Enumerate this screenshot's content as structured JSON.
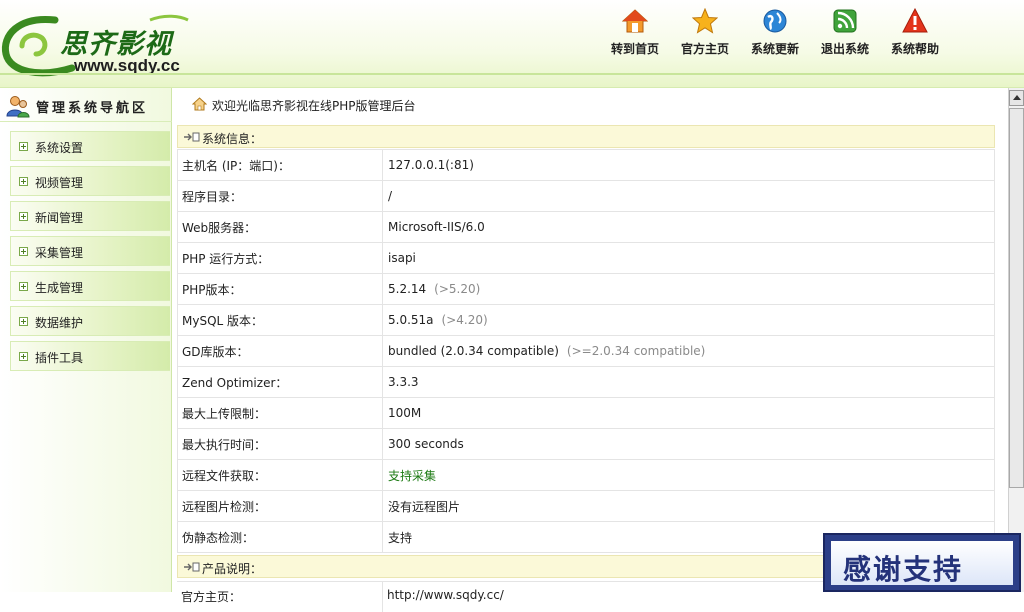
{
  "brand": {
    "name_cn": "思齐影视",
    "url": "www.sqdy.cc",
    "logo_color": "#1d6a17"
  },
  "top_nav": [
    {
      "label": "转到首页",
      "icon": "home-icon"
    },
    {
      "label": "官方主页",
      "icon": "star-icon"
    },
    {
      "label": "系统更新",
      "icon": "globe-icon"
    },
    {
      "label": "退出系统",
      "icon": "rss-exit-icon"
    },
    {
      "label": "系统帮助",
      "icon": "warning-icon"
    }
  ],
  "sidebar": {
    "title": "管理系统导航区",
    "items": [
      {
        "label": "系统设置"
      },
      {
        "label": "视频管理"
      },
      {
        "label": "新闻管理"
      },
      {
        "label": "采集管理"
      },
      {
        "label": "生成管理"
      },
      {
        "label": "数据维护"
      },
      {
        "label": "插件工具"
      }
    ]
  },
  "breadcrumb": "欢迎光临思齐影视在线PHP版管理后台",
  "system_info": {
    "title": "系统信息：",
    "rows": [
      {
        "key": "主机名 (IP：端口)：",
        "value": "127.0.0.1(:81)",
        "hint": ""
      },
      {
        "key": "程序目录：",
        "value": "/",
        "hint": ""
      },
      {
        "key": "Web服务器：",
        "value": "Microsoft-IIS/6.0",
        "hint": ""
      },
      {
        "key": "PHP 运行方式：",
        "value": "isapi",
        "hint": ""
      },
      {
        "key": "PHP版本：",
        "value": "5.2.14",
        "hint": "(>5.20)"
      },
      {
        "key": "MySQL 版本：",
        "value": "5.0.51a",
        "hint": "(>4.20)"
      },
      {
        "key": "GD库版本：",
        "value": "bundled (2.0.34 compatible)",
        "hint": "(>=2.0.34 compatible)"
      },
      {
        "key": "Zend Optimizer：",
        "value": "3.3.3",
        "hint": ""
      },
      {
        "key": "最大上传限制：",
        "value": "100M",
        "hint": ""
      },
      {
        "key": "最大执行时间：",
        "value": "300 seconds",
        "hint": ""
      },
      {
        "key": "远程文件获取：",
        "value": "支持采集",
        "hint": "",
        "highlight": true
      },
      {
        "key": "远程图片检测：",
        "value": "没有远程图片",
        "hint": ""
      },
      {
        "key": "伪静态检测：",
        "value": "支持",
        "hint": ""
      }
    ]
  },
  "product_info": {
    "title": "产品说明：",
    "partial_row": {
      "key": "官方主页：",
      "value": "http://www.sqdy.cc/"
    }
  },
  "overlay": {
    "text": "感谢支持"
  },
  "colors": {
    "accent_green": "#1b7a12",
    "hint_gray": "#8a8a8a",
    "section_bg": "#fbf9d8",
    "badge_blue": "#2c3f88"
  }
}
